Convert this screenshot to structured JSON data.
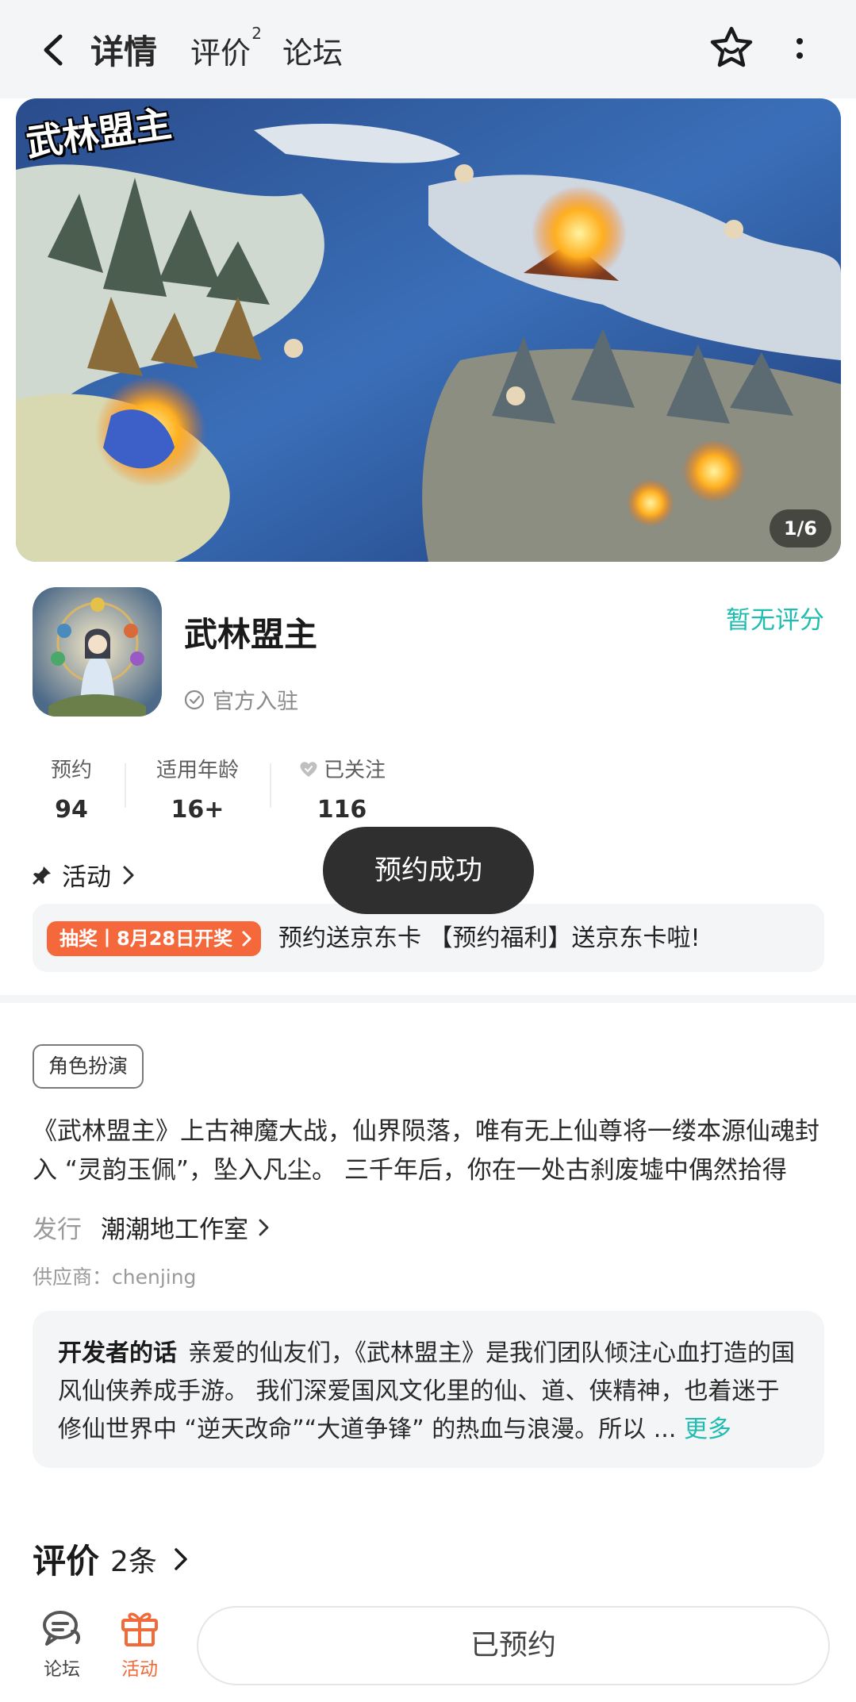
{
  "nav": {
    "tabs": [
      {
        "label": "详情",
        "active": true
      },
      {
        "label": "评价",
        "sup": "2"
      },
      {
        "label": "论坛"
      }
    ],
    "icons": [
      "back-arrow-icon",
      "star-favorite-icon",
      "more-vertical-icon"
    ]
  },
  "banner": {
    "logo_text": "武林盟主",
    "pager": "1/6"
  },
  "app": {
    "name": "武林盟主",
    "official": "官方入驻",
    "rating": "暂无评分"
  },
  "stats": [
    {
      "label": "预约",
      "value": "94"
    },
    {
      "label": "适用年龄",
      "value": "16+"
    },
    {
      "label": "已关注",
      "value": "116"
    }
  ],
  "activity": {
    "label": "活动"
  },
  "toast": "预约成功",
  "promo": {
    "badge": "抽奖丨8月28日开奖",
    "text": "预约送京东卡 【预约福利】送京东卡啦!"
  },
  "tag": "角色扮演",
  "description": "《武林盟主》上古神魔大战，仙界陨落，唯有无上仙尊将一缕本源仙魂封入 “灵韵玉佩”，坠入凡尘。 三千年后，你在一处古刹废墟中偶然拾得此...",
  "publisher": {
    "key": "发行",
    "value": "潮潮地工作室"
  },
  "supplier": "供应商：chenjing",
  "developer_note": {
    "heading": "开发者的话",
    "text": "亲爱的仙友们，《武林盟主》是我们团队倾注心血打造的国风仙侠养成手游。 我们深爱国风文化里的仙、道、侠精神，也着迷于修仙世界中 “逆天改命”“大道争锋” 的热血与浪漫。所以 ...",
    "more": "更多"
  },
  "reviews": {
    "title": "评价",
    "count": "2条"
  },
  "bottom": {
    "forum": "论坛",
    "activity": "活动",
    "cta": "已预约"
  },
  "colors": {
    "accent": "#22d3c4",
    "rating": "#1fbcb0",
    "promo": "#f4683c",
    "active_tab_icon": "#f06a3a"
  }
}
